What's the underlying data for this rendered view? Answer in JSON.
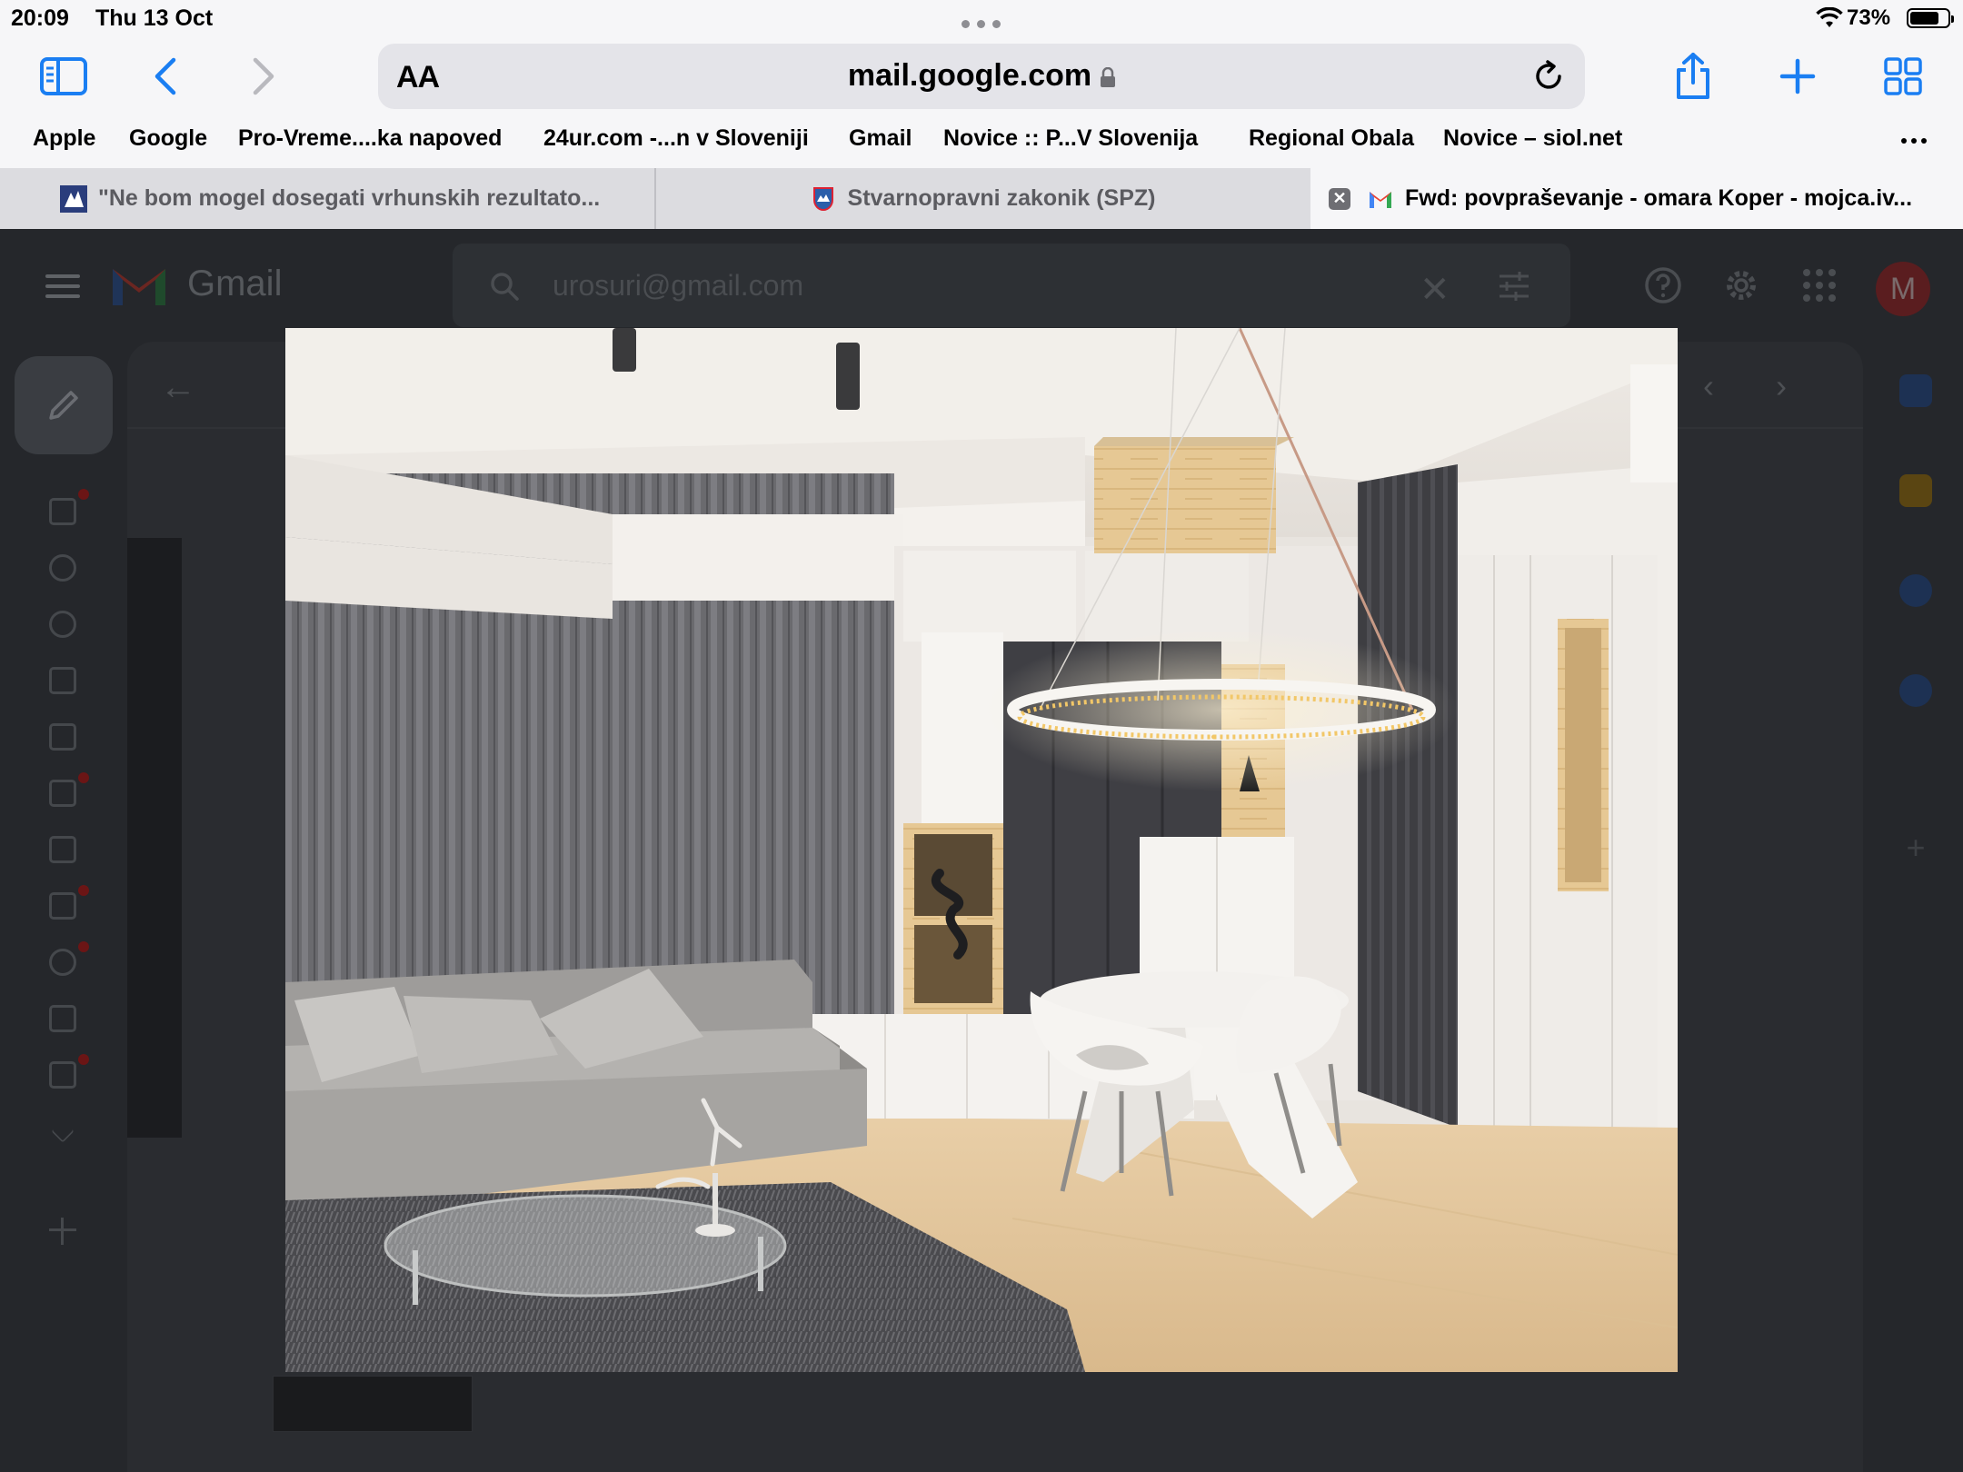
{
  "status_bar": {
    "time": "20:09",
    "date": "Thu 13 Oct",
    "battery": "73%"
  },
  "toolbar": {
    "reader_aa": "AA",
    "url": "mail.google.com"
  },
  "favorites": [
    "Apple",
    "Google",
    "Pro-Vreme....ka napoved",
    "24ur.com -...n v Sloveniji",
    "Gmail",
    "Novice :: P...V Slovenija",
    "Regional Obala",
    "Novice – siol.net"
  ],
  "tabs": [
    {
      "title": "\"Ne bom mogel dosegati vrhunskih rezultato...",
      "active": false
    },
    {
      "title": "Stvarnopravni zakonik (SPZ)",
      "active": false
    },
    {
      "title": "Fwd: povpraševanje - omara Koper - mojca.iv...",
      "active": true
    }
  ],
  "gmail": {
    "app_name": "Gmail",
    "search_text": "urosuri@gmail.com",
    "avatar_letter": "M"
  },
  "colors": {
    "accent_blue": "#1a7ef2",
    "gmail_red": "#ea4335"
  }
}
